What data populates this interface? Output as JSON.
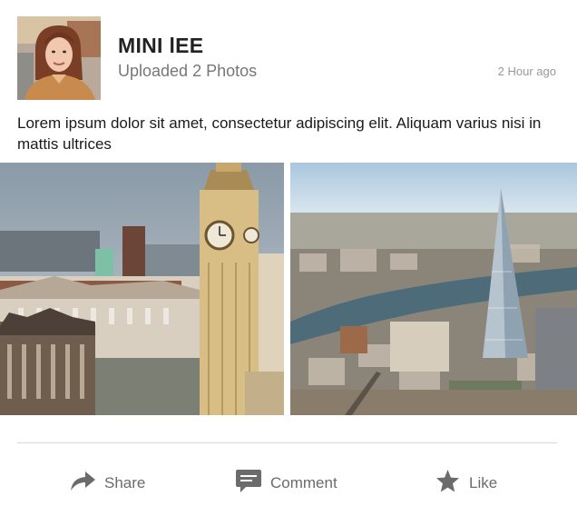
{
  "post": {
    "author": "MINI lEE",
    "subtitle": "Uploaded 2 Photos",
    "timestamp": "2 Hour ago",
    "body": "Lorem ipsum dolor sit amet, consectetur adipiscing elit. Aliquam varius nisi in mattis ultrices"
  },
  "photos": [
    {
      "subject": "big-ben-photo"
    },
    {
      "subject": "london-shard-aerial-photo"
    }
  ],
  "actions": {
    "share": {
      "label": "Share",
      "icon": "share-arrow-icon"
    },
    "comment": {
      "label": "Comment",
      "icon": "comment-bubble-icon"
    },
    "like": {
      "label": "Like",
      "icon": "star-icon"
    }
  },
  "colors": {
    "icon": "#6b6b6b",
    "text_secondary": "#777777",
    "divider": "#d9d9d9"
  }
}
